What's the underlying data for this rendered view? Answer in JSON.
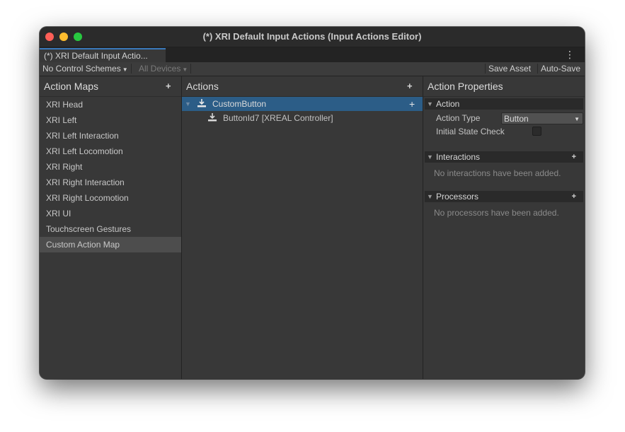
{
  "window": {
    "title": "(*) XRI Default Input Actions (Input Actions Editor)",
    "tab_label": "(*) XRI Default Input Actio...",
    "menu_icon": "kebab-menu-icon"
  },
  "toolbar": {
    "control_scheme": "No Control Schemes",
    "devices": "All Devices",
    "save_asset": "Save Asset",
    "auto_save": "Auto-Save"
  },
  "action_maps": {
    "title": "Action Maps",
    "add_label": "+",
    "items": [
      {
        "label": "XRI Head"
      },
      {
        "label": "XRI Left"
      },
      {
        "label": "XRI Left Interaction"
      },
      {
        "label": "XRI Left Locomotion"
      },
      {
        "label": "XRI Right"
      },
      {
        "label": "XRI Right Interaction"
      },
      {
        "label": "XRI Right Locomotion"
      },
      {
        "label": "XRI UI"
      },
      {
        "label": "Touchscreen Gestures"
      },
      {
        "label": "Custom Action Map"
      }
    ],
    "selected_index": 9
  },
  "actions": {
    "title": "Actions",
    "add_label": "+",
    "action": {
      "label": "CustomButton",
      "add_binding": "+"
    },
    "binding": {
      "label": "ButtonId7 [XREAL Controller]"
    }
  },
  "properties": {
    "title": "Action Properties",
    "action_section": {
      "label": "Action",
      "action_type_label": "Action Type",
      "action_type_value": "Button",
      "initial_state_label": "Initial State Check",
      "initial_state_checked": false
    },
    "interactions": {
      "label": "Interactions",
      "add_label": "+",
      "empty": "No interactions have been added."
    },
    "processors": {
      "label": "Processors",
      "add_label": "+",
      "empty": "No processors have been added."
    }
  },
  "colors": {
    "selection": "#2c5d87",
    "tab_accent": "#3a79bb",
    "close": "#fe5f57",
    "minimize": "#febc2e",
    "maximize": "#28c840"
  }
}
